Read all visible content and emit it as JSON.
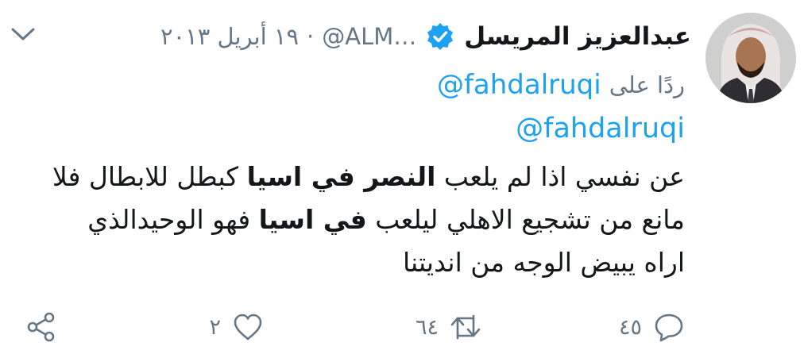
{
  "tweet": {
    "author_name": "عبدالعزيز المريسل",
    "handle": "@ALM…",
    "separator": "·",
    "date": "١٩ أبريل ٢٠١٣",
    "replying_label": "ردًا على",
    "replying_to": "@fahdalruqi",
    "mention": "@fahdalruqi",
    "text_lines": [
      [
        {
          "t": "عن نفسي اذا لم يلعب ",
          "b": false
        },
        {
          "t": "النصر في اسيا",
          "b": true
        },
        {
          "t": " كبطل للابطال فلا",
          "b": false
        }
      ],
      [
        {
          "t": "مانع من تشجيع الاهلي ليلعب ",
          "b": false
        },
        {
          "t": "في اسيا",
          "b": true
        },
        {
          "t": " فهو الوحيدالذي",
          "b": false
        }
      ],
      [
        {
          "t": "اراه يبيض الوجه من انديتنا",
          "b": false
        }
      ]
    ]
  },
  "actions": {
    "reply_count": "٤٥",
    "retweet_count": "٦٤",
    "like_count": "٢"
  },
  "colors": {
    "accent": "#1da1f2",
    "muted": "#657786",
    "text": "#14171a"
  },
  "icons": [
    "avatar",
    "verified-badge-icon",
    "chevron-down-icon",
    "reply-icon",
    "retweet-icon",
    "heart-icon",
    "share-icon"
  ]
}
